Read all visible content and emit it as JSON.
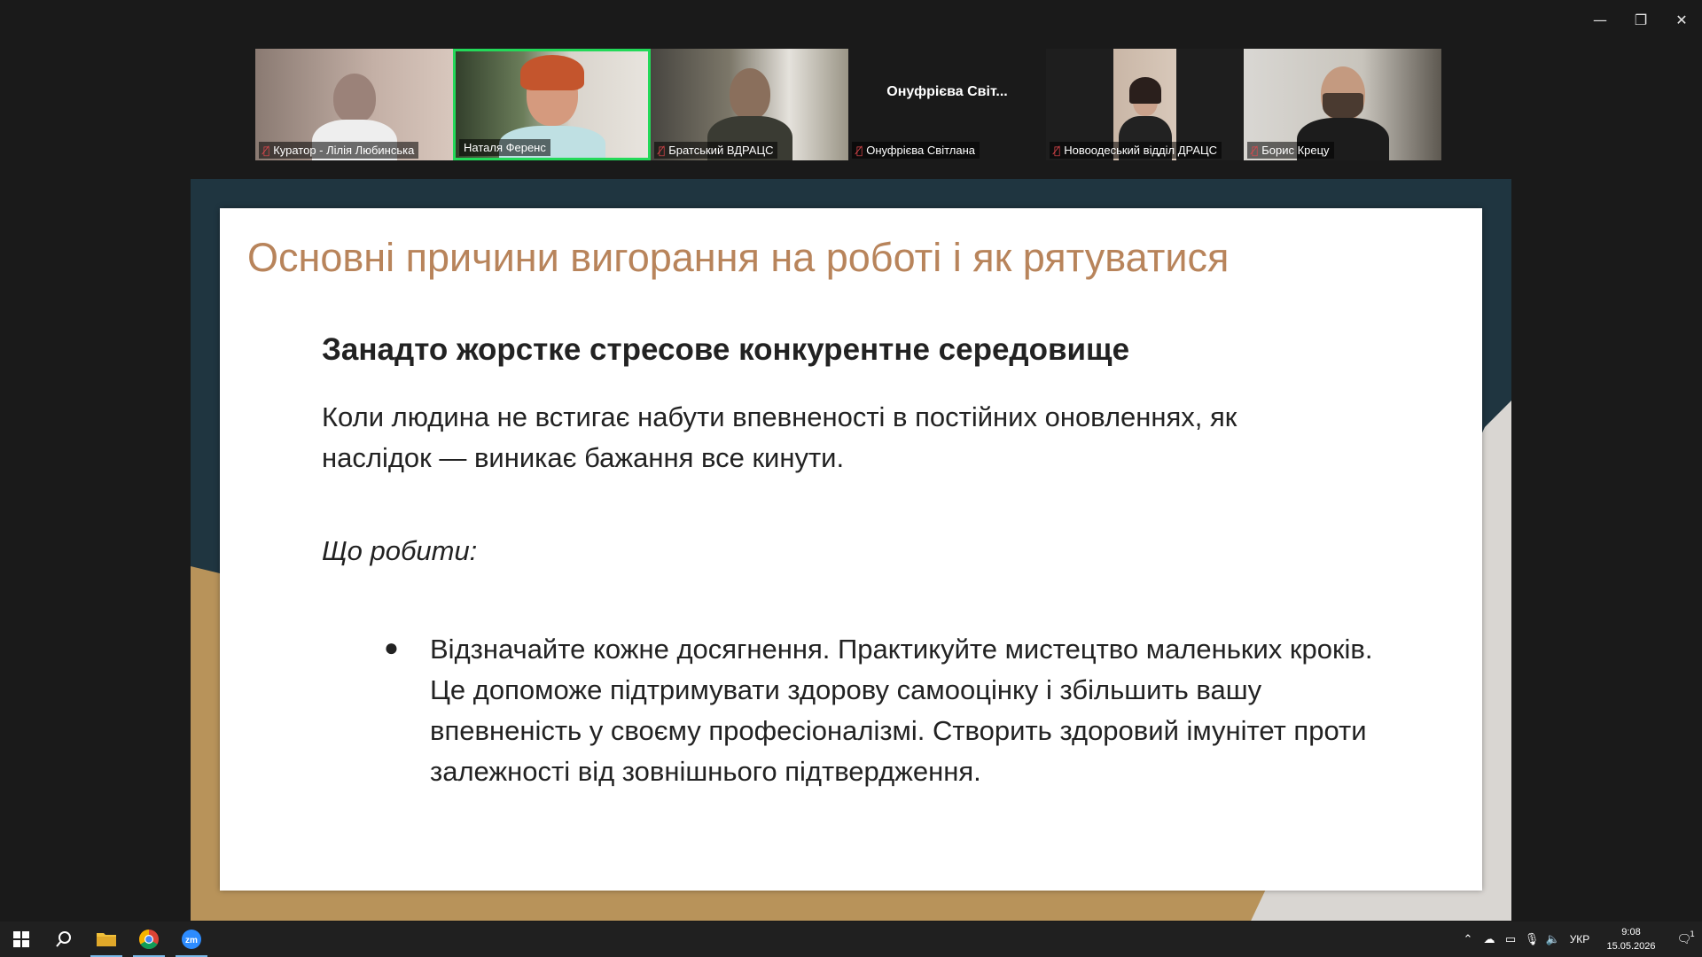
{
  "window": {
    "minimize": "—",
    "restore": "❐",
    "close": "✕"
  },
  "participants": [
    {
      "name": "Куратор - Лілія Любинська",
      "muted": true,
      "video": true,
      "speaking": false
    },
    {
      "name": "Наталя Ференс",
      "muted": false,
      "video": true,
      "speaking": true
    },
    {
      "name": "Братський ВДРАЦС",
      "muted": true,
      "video": true,
      "speaking": false
    },
    {
      "name": "Онуфрієва Світлана",
      "display_name": "Онуфрієва Світ...",
      "muted": true,
      "video": false,
      "speaking": false
    },
    {
      "name": "Новоодеський відділ ДРАЦС",
      "muted": true,
      "video": true,
      "speaking": false
    },
    {
      "name": "Борис Крецу",
      "muted": true,
      "video": true,
      "speaking": false
    }
  ],
  "slide": {
    "title": "Основні причини вигорання на роботі і як рятуватися",
    "heading": "Занадто жорстке стресове конкурентне середовище",
    "paragraph": "Коли людина не встигає набути впевненості в постійних оновленнях, як наслідок — виникає бажання все кинути.",
    "what_to_do": "Що робити:",
    "bullet_mark": "●",
    "bullet": "Відзначайте кожне досягнення. Практикуйте мистецтво маленьких кроків. Це допоможе підтримувати здорову самооцінку і збільшить вашу впевненість у своєму професіоналізмі. Створить здоровий імунітет проти залежності від зовнішнього підтвердження."
  },
  "taskbar": {
    "language": "УКР",
    "time": "9:08",
    "date": "15.05.2026",
    "notifications": "1"
  },
  "colors": {
    "title": "#b8845b",
    "speaker_border": "#23d959",
    "muted_icon": "#e5484d"
  }
}
